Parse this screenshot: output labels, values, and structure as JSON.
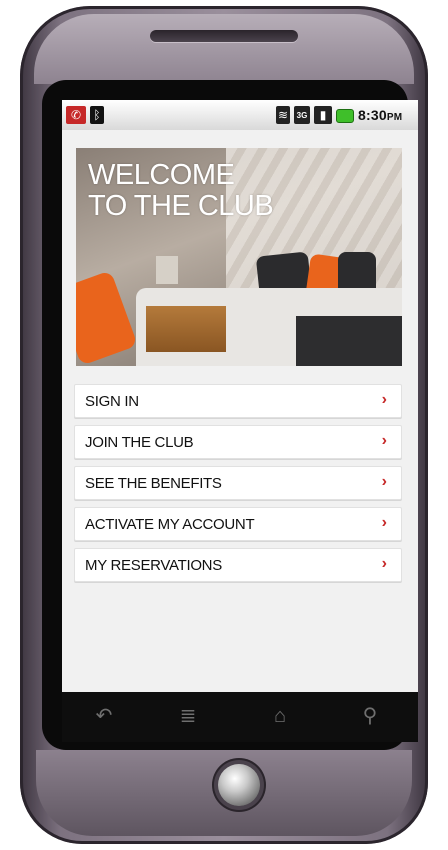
{
  "status_bar": {
    "time": "8:30",
    "time_suffix": "PM",
    "icons": [
      "missed-call-icon",
      "bluetooth-icon",
      "wifi-icon",
      "3g-icon",
      "signal-icon",
      "battery-icon"
    ],
    "three_g_label": "3G"
  },
  "hero": {
    "title_line1": "WELCOME",
    "title_line2": "TO THE CLUB"
  },
  "menu": {
    "items": [
      {
        "label": "SIGN IN"
      },
      {
        "label": "JOIN THE CLUB"
      },
      {
        "label": "SEE THE BENEFITS"
      },
      {
        "label": "ACTIVATE MY ACCOUNT"
      },
      {
        "label": "MY RESERVATIONS"
      }
    ],
    "chevron": "›"
  },
  "nav": {
    "back": "↶",
    "menu": "≣",
    "home": "⌂",
    "search": "⚲"
  },
  "colors": {
    "accent": "#c62828",
    "screen_bg": "#f1f1f1"
  }
}
